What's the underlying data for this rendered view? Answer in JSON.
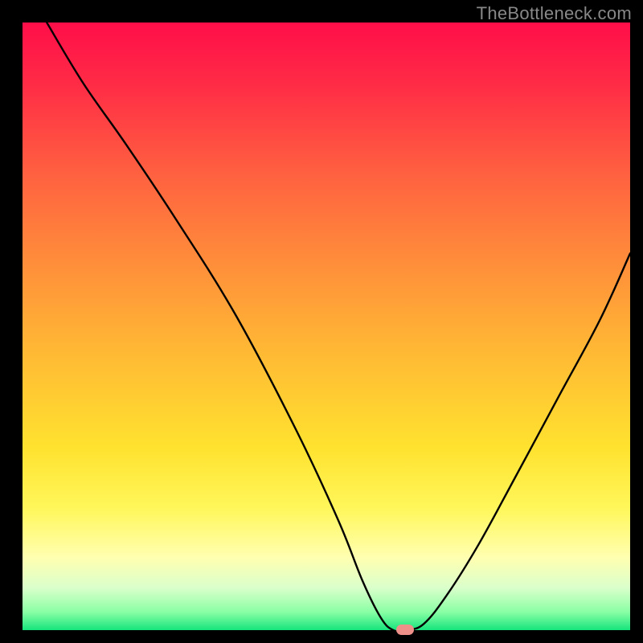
{
  "watermark": "TheBottleneck.com",
  "colors": {
    "gradient_stops": [
      {
        "offset": 0.0,
        "color": "#ff0e49"
      },
      {
        "offset": 0.1,
        "color": "#ff2b46"
      },
      {
        "offset": 0.25,
        "color": "#ff6140"
      },
      {
        "offset": 0.4,
        "color": "#ff8f3a"
      },
      {
        "offset": 0.55,
        "color": "#ffbb34"
      },
      {
        "offset": 0.7,
        "color": "#ffe22f"
      },
      {
        "offset": 0.8,
        "color": "#fff75b"
      },
      {
        "offset": 0.88,
        "color": "#ffffb0"
      },
      {
        "offset": 0.93,
        "color": "#dbffcb"
      },
      {
        "offset": 0.97,
        "color": "#8affa5"
      },
      {
        "offset": 1.0,
        "color": "#16e47c"
      }
    ],
    "curve": "#000000",
    "marker": "#ee8f8a",
    "frame": "#000000"
  },
  "chart_data": {
    "type": "line",
    "title": "",
    "xlabel": "",
    "ylabel": "",
    "xlim": [
      0,
      100
    ],
    "ylim": [
      0,
      100
    ],
    "grid": false,
    "series": [
      {
        "name": "bottleneck-curve",
        "x": [
          4,
          10,
          17,
          25,
          35,
          45,
          52,
          56,
          59,
          61,
          63,
          66,
          70,
          75,
          81,
          88,
          95,
          100
        ],
        "values": [
          100,
          90,
          80,
          68,
          52,
          33,
          18,
          8,
          2,
          0,
          0,
          1,
          6,
          14,
          25,
          38,
          51,
          62
        ]
      }
    ],
    "marker": {
      "x": 63,
      "y": 0
    },
    "note": "x in percent of plot width from left, values in percent of plot height from bottom; values estimated from pixel positions"
  }
}
